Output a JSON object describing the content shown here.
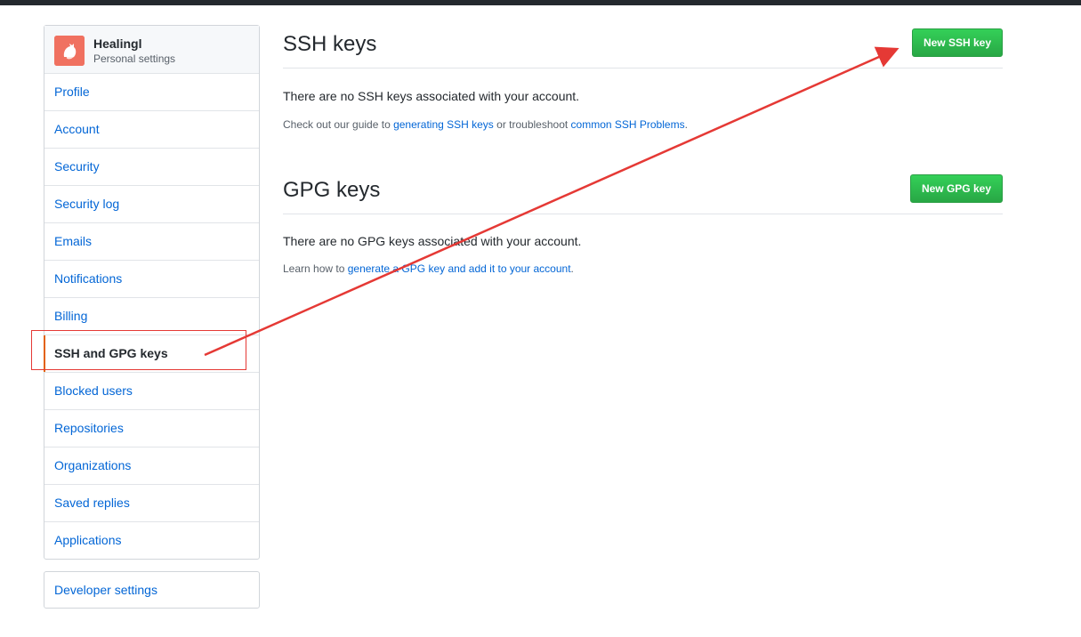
{
  "sidebar": {
    "user_name": "Healingl",
    "user_subtitle": "Personal settings",
    "items": [
      {
        "label": "Profile"
      },
      {
        "label": "Account"
      },
      {
        "label": "Security"
      },
      {
        "label": "Security log"
      },
      {
        "label": "Emails"
      },
      {
        "label": "Notifications"
      },
      {
        "label": "Billing"
      },
      {
        "label": "SSH and GPG keys",
        "selected": true
      },
      {
        "label": "Blocked users"
      },
      {
        "label": "Repositories"
      },
      {
        "label": "Organizations"
      },
      {
        "label": "Saved replies"
      },
      {
        "label": "Applications"
      }
    ],
    "developer_settings": "Developer settings"
  },
  "ssh": {
    "title": "SSH keys",
    "button": "New SSH key",
    "empty_message": "There are no SSH keys associated with your account.",
    "note_prefix": "Check out our guide to ",
    "link1": "generating SSH keys",
    "note_mid": " or troubleshoot ",
    "link2": "common SSH Problems",
    "note_suffix": "."
  },
  "gpg": {
    "title": "GPG keys",
    "button": "New GPG key",
    "empty_message": "There are no GPG keys associated with your account.",
    "note_prefix": "Learn how to ",
    "link": "generate a GPG key and add it to your account",
    "note_suffix": "."
  },
  "colors": {
    "link": "#0366d6",
    "primary_button": "#28a745",
    "selected_indicator": "#e36209",
    "annotation": "#e53935"
  }
}
